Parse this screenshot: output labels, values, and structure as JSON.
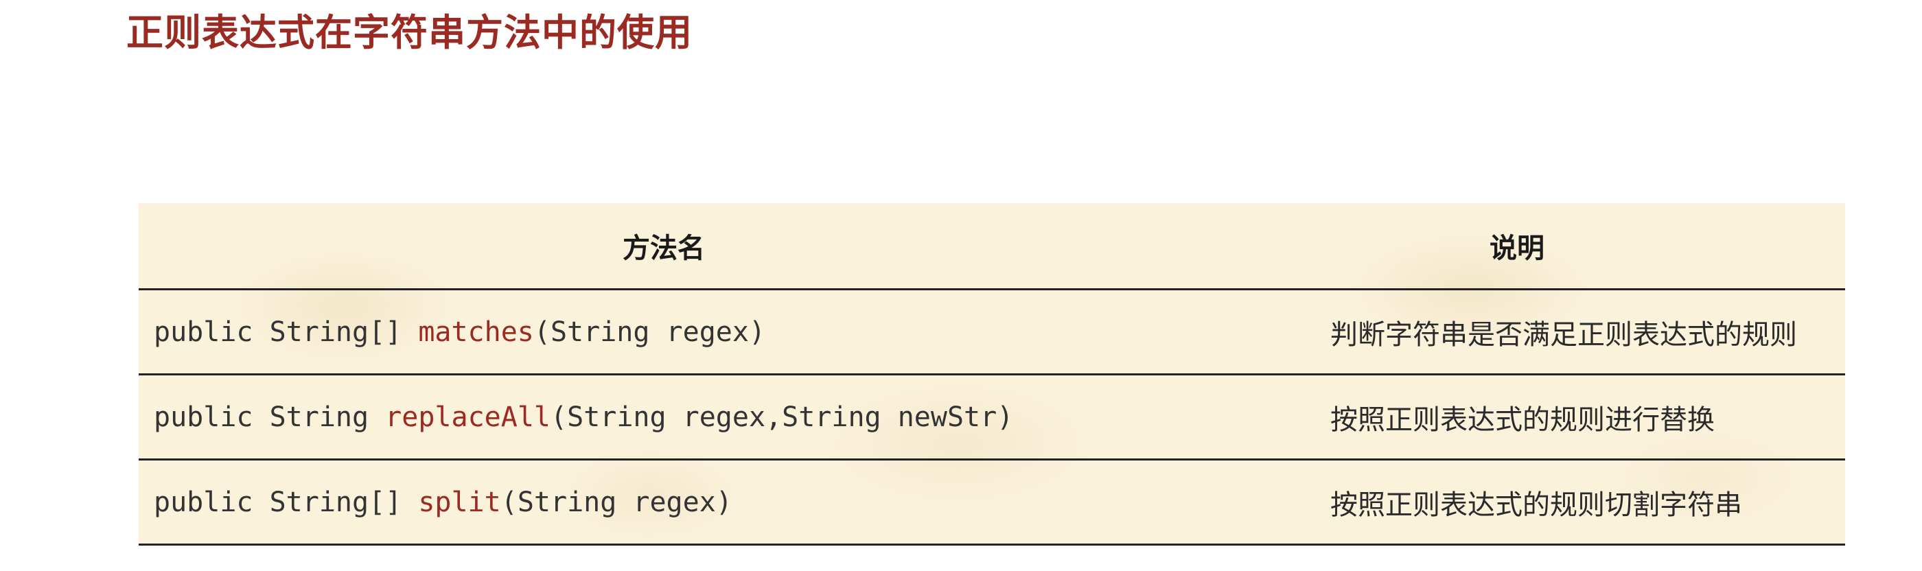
{
  "title": "正则表达式在字符串方法中的使用",
  "table": {
    "headers": [
      "方法名",
      "说明"
    ],
    "rows": [
      {
        "method_prefix": "public String[] ",
        "method_name": "matches",
        "method_suffix": "(String regex)",
        "description": "判断字符串是否满足正则表达式的规则"
      },
      {
        "method_prefix": "public String ",
        "method_name": "replaceAll",
        "method_suffix": "(String regex,String newStr)",
        "description": "按照正则表达式的规则进行替换"
      },
      {
        "method_prefix": "public String[] ",
        "method_name": "split",
        "method_suffix": "(String regex)",
        "description": "按照正则表达式的规则切割字符串"
      }
    ]
  },
  "colors": {
    "title": "#9b2a22",
    "method_name": "#9b2a22",
    "table_background": "#fbf2dc",
    "rule": "#222222"
  }
}
